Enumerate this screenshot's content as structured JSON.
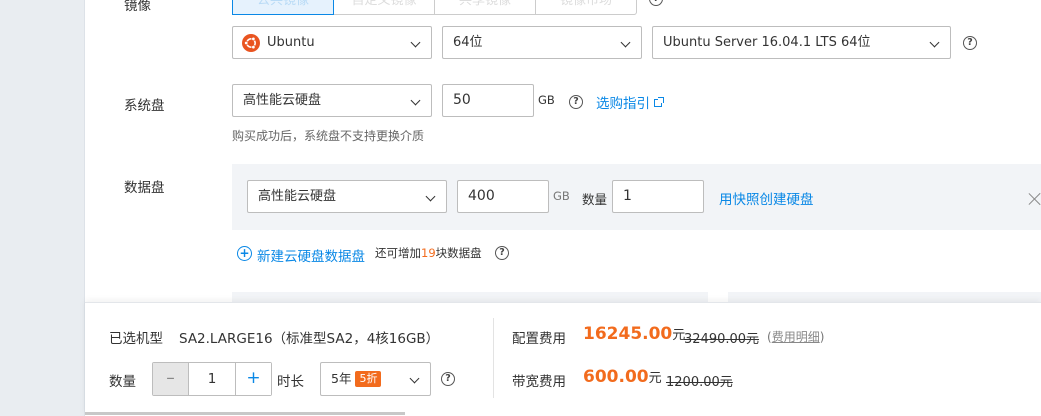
{
  "image_section": {
    "label": "镜像",
    "tabs": [
      "公共镜像",
      "自定义镜像",
      "共享镜像",
      "镜像市场"
    ],
    "os_select": "Ubuntu",
    "arch_select": "64位",
    "version_select": "Ubuntu Server 16.04.1 LTS 64位"
  },
  "system_disk": {
    "label": "系统盘",
    "type_select": "高性能云硬盘",
    "size_value": "50",
    "unit": "GB",
    "guide_link": "选购指引",
    "hint": "购买成功后，系统盘不支持更换介质"
  },
  "data_disk": {
    "label": "数据盘",
    "type_select": "高性能云硬盘",
    "size_value": "400",
    "unit": "GB",
    "qty_label": "数量",
    "qty_value": "1",
    "snapshot_link": "用快照创建硬盘",
    "add_link": "新建云硬盘数据盘",
    "add_hint_prefix": "还可增加",
    "add_hint_count": "19",
    "add_hint_suffix": "块数据盘"
  },
  "footer": {
    "selected_label": "已选机型",
    "selected_value": "SA2.LARGE16（标准型SA2，4核16GB）",
    "qty_label": "数量",
    "qty_value": "1",
    "duration_label": "时长",
    "duration_value": "5年",
    "discount_badge": "5折",
    "config_fee_label": "配置费用",
    "config_fee_price": "16245.00",
    "config_fee_unit": "元",
    "config_fee_original": "32490.00元",
    "fee_detail_open": "(",
    "fee_detail_link": "费用明细",
    "fee_detail_close": ")",
    "bandwidth_fee_label": "带宽费用",
    "bandwidth_fee_price": "600.00",
    "bandwidth_fee_unit": "元",
    "bandwidth_fee_original": "1200.00元"
  },
  "colors": {
    "accent": "#0a88e6",
    "price": "#f26b1d",
    "ubuntu": "#e95420"
  }
}
